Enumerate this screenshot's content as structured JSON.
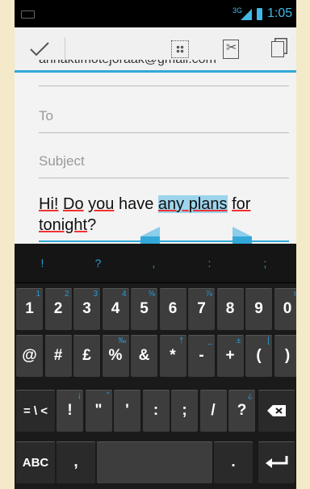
{
  "status_bar": {
    "network": "3G",
    "time": "1:05"
  },
  "action_bar": {
    "done_icon": "check-icon",
    "select_all_icon": "select-all-icon",
    "cut_icon": "cut-icon",
    "copy_icon": "copy-icon"
  },
  "compose": {
    "from_value": "annaktimotejoraak@gmail.com",
    "to_placeholder": "To",
    "subject_placeholder": "Subject",
    "body": {
      "w1": "Hi!",
      "w2": "Do",
      "w3": "you",
      "w4": "have",
      "sel1": "any",
      "sel2": "plans",
      "w5": "for",
      "w6": "tonight",
      "end": "?"
    }
  },
  "keyboard": {
    "suggestions": [
      "!",
      "?",
      ",",
      ":",
      ";"
    ],
    "row1": [
      {
        "label": "1",
        "hint": "1"
      },
      {
        "label": "2",
        "hint": "2"
      },
      {
        "label": "3",
        "hint": "3"
      },
      {
        "label": "4",
        "hint": "4"
      },
      {
        "label": "5",
        "hint": "⅝"
      },
      {
        "label": "6",
        "hint": ""
      },
      {
        "label": "7",
        "hint": "⅞"
      },
      {
        "label": "8",
        "hint": ""
      },
      {
        "label": "9",
        "hint": ""
      },
      {
        "label": "0",
        "hint": "n"
      }
    ],
    "row2": [
      {
        "label": "@",
        "hint": ""
      },
      {
        "label": "#",
        "hint": ""
      },
      {
        "label": "£",
        "hint": ""
      },
      {
        "label": "%",
        "hint": "‰"
      },
      {
        "label": "&",
        "hint": ""
      },
      {
        "label": "*",
        "hint": "†"
      },
      {
        "label": "-",
        "hint": "_"
      },
      {
        "label": "+",
        "hint": "±"
      },
      {
        "label": "(",
        "hint": "["
      },
      {
        "label": ")",
        "hint": "]"
      }
    ],
    "row3": [
      {
        "label": "= \\ <",
        "hint": ""
      },
      {
        "label": "!",
        "hint": "¡"
      },
      {
        "label": "\"",
        "hint": "\""
      },
      {
        "label": "'",
        "hint": ""
      },
      {
        "label": ":",
        "hint": ""
      },
      {
        "label": ";",
        "hint": ""
      },
      {
        "label": "/",
        "hint": ""
      },
      {
        "label": "?",
        "hint": "¿"
      }
    ],
    "abc_label": "ABC",
    "comma_label": ",",
    "period_label": ".",
    "backspace_icon": "backspace-icon",
    "enter_icon": "enter-icon"
  }
}
